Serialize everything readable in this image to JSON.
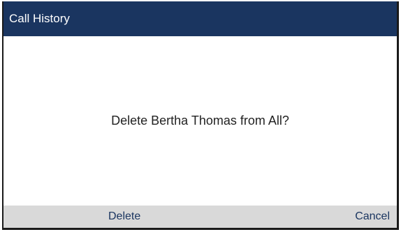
{
  "header": {
    "title": "Call History"
  },
  "dialog": {
    "message": "Delete Bertha Thomas from All?"
  },
  "softkeys": {
    "delete_label": "Delete",
    "cancel_label": "Cancel"
  },
  "colors": {
    "titlebar_bg": "#1a3560",
    "softkey_bar_bg": "#d9d9d9",
    "softkey_text": "#1a3560"
  }
}
